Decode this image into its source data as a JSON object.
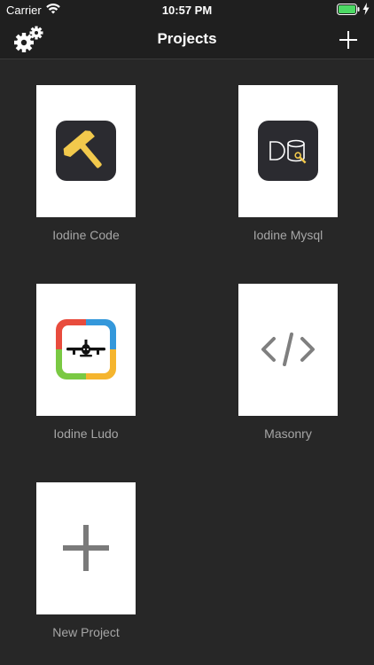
{
  "status_bar": {
    "carrier": "Carrier",
    "time": "10:57 PM",
    "battery_color": "#4cd964"
  },
  "nav": {
    "title": "Projects"
  },
  "projects": [
    {
      "label": "Iodine Code",
      "icon": "hammer-icon"
    },
    {
      "label": "Iodine Mysql",
      "icon": "database-icon"
    },
    {
      "label": "Iodine Ludo",
      "icon": "airplane-icon"
    },
    {
      "label": "Masonry",
      "icon": "code-brackets-icon"
    },
    {
      "label": "New Project",
      "icon": "plus-icon"
    }
  ],
  "colors": {
    "background": "#272727",
    "bar": "#1f1f1f",
    "label": "#a6a6a6",
    "hammer_yellow": "#f2c94c",
    "ludo_red": "#e84c3d",
    "ludo_blue": "#3498db",
    "ludo_green": "#7ac943",
    "ludo_yellow": "#f5b52e"
  }
}
